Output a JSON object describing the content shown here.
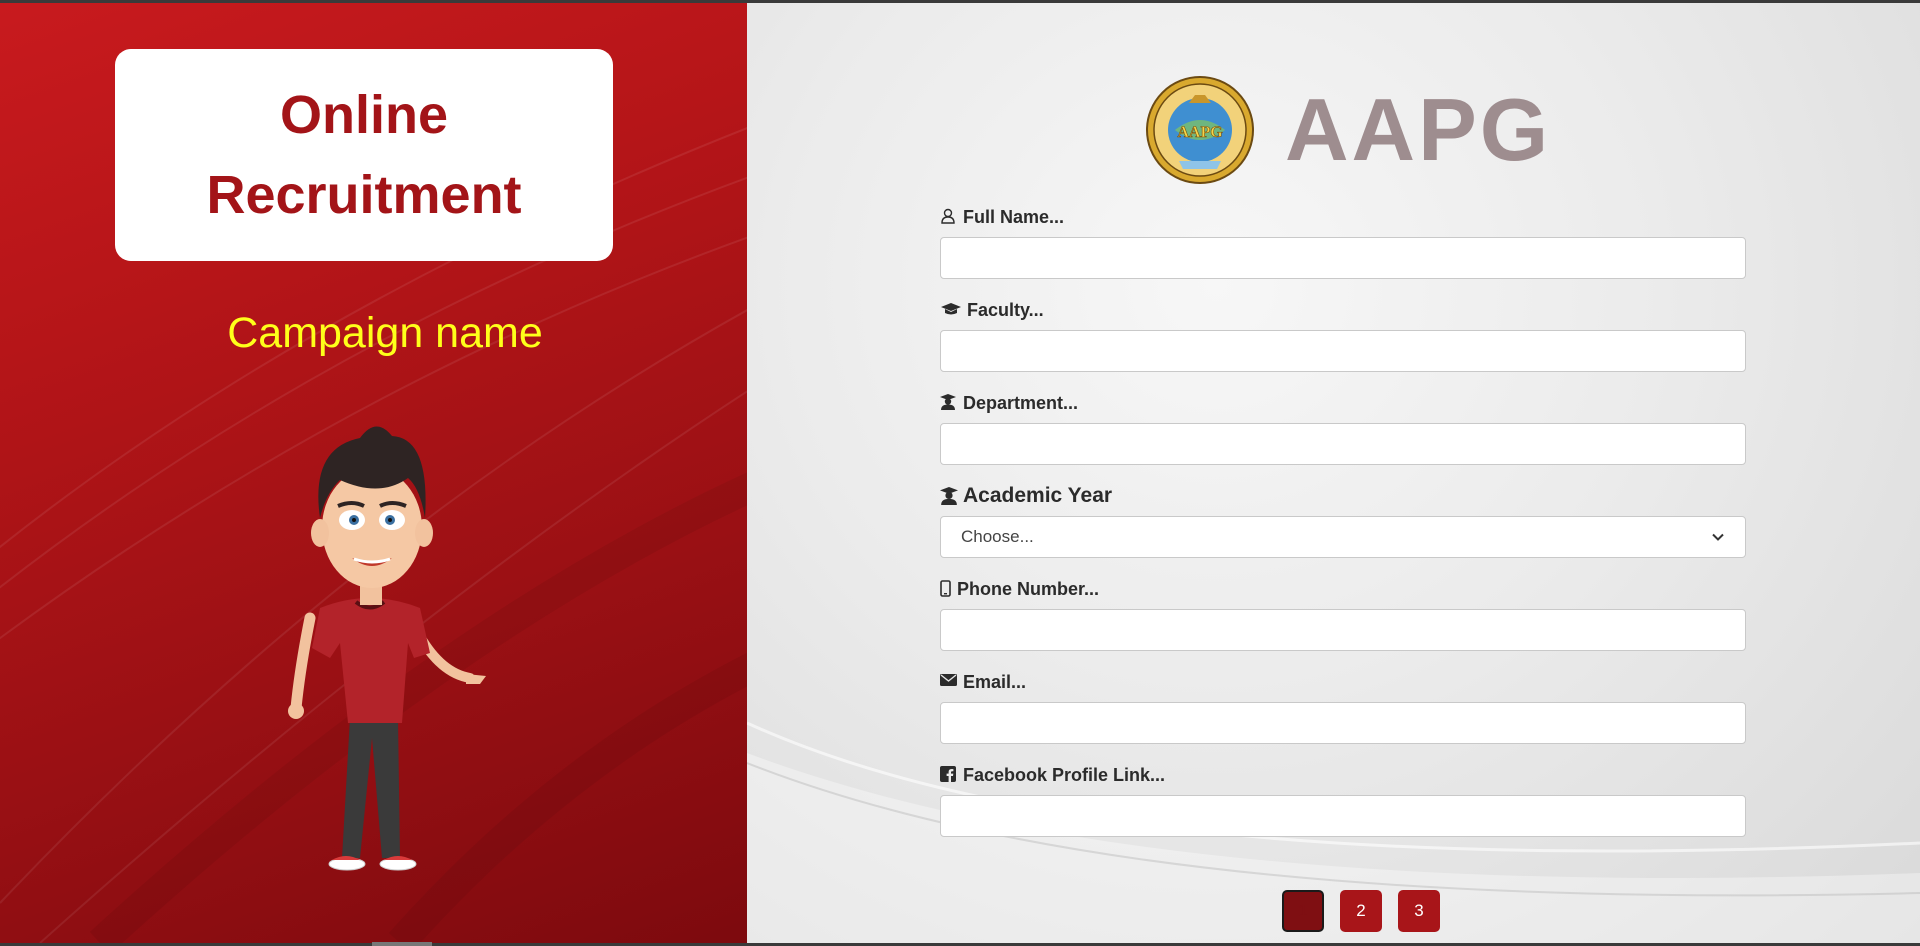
{
  "hero": {
    "title_line1": "Online",
    "title_line2": "Recruitment",
    "campaign": "Campaign name"
  },
  "brand": {
    "name": "AAPG",
    "seal_text_top": "AMERICAN ASSOCIATION OF PETROLEUM GEOLOGISTS",
    "seal_center": "AAPG"
  },
  "form": {
    "full_name_label": "Full Name...",
    "faculty_label": "Faculty...",
    "department_label": "Department...",
    "academic_year_label": "Academic Year",
    "academic_year_selected": "Choose...",
    "phone_label": "Phone Number...",
    "email_label": "Email...",
    "facebook_label": "Facebook Profile Link..."
  },
  "pagination": {
    "pages": [
      "1",
      "2",
      "3"
    ],
    "current": "1"
  },
  "colors": {
    "primary_red": "#a81519",
    "title_red": "#a31418",
    "campaign_yellow": "#ffff1a",
    "brand_gray": "#9e8d8f"
  }
}
